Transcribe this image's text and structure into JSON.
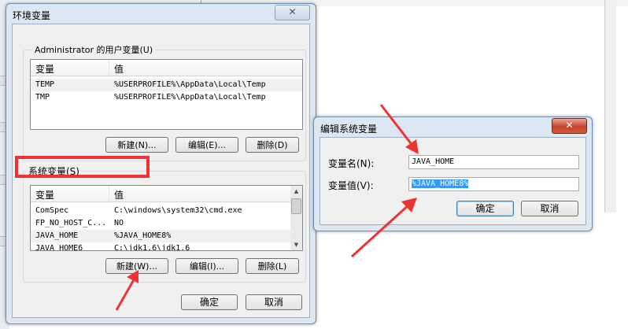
{
  "env_dialog": {
    "title": "环境变量",
    "close_label": "✕",
    "user_group_label": "Administrator 的用户变量(U)",
    "user_columns": [
      "变量",
      "值"
    ],
    "user_rows": [
      {
        "name": "TEMP",
        "value": "%USERPROFILE%\\AppData\\Local\\Temp"
      },
      {
        "name": "TMP",
        "value": "%USERPROFILE%\\AppData\\Local\\Temp"
      }
    ],
    "user_buttons": {
      "new": "新建(N)...",
      "edit": "编辑(E)...",
      "delete": "删除(D)"
    },
    "system_group_label": "系统变量(S)",
    "system_columns": [
      "变量",
      "值"
    ],
    "system_rows": [
      {
        "name": "ComSpec",
        "value": "C:\\windows\\system32\\cmd.exe"
      },
      {
        "name": "FP_NO_HOST_C...",
        "value": "NO"
      },
      {
        "name": "JAVA_HOME",
        "value": "%JAVA_HOME8%"
      },
      {
        "name": "JAVA_HOME6",
        "value": "C:\\jdk1.6\\jdk1.6"
      }
    ],
    "system_buttons": {
      "new": "新建(W)...",
      "edit": "编辑(I)...",
      "delete": "删除(L)"
    },
    "ok_label": "确定",
    "cancel_label": "取消"
  },
  "edit_dialog": {
    "title": "编辑系统变量",
    "close_label": "✕",
    "name_label": "变量名(N):",
    "name_value": "JAVA_HOME",
    "value_label": "变量值(V):",
    "value_value": "%JAVA_HOME8%",
    "ok_label": "确定",
    "cancel_label": "取消"
  },
  "annotation_color": "#ee3333",
  "icons": {
    "close": "close-icon",
    "scroll_up": "scroll-up-icon",
    "scroll_down": "scroll-down-icon"
  }
}
